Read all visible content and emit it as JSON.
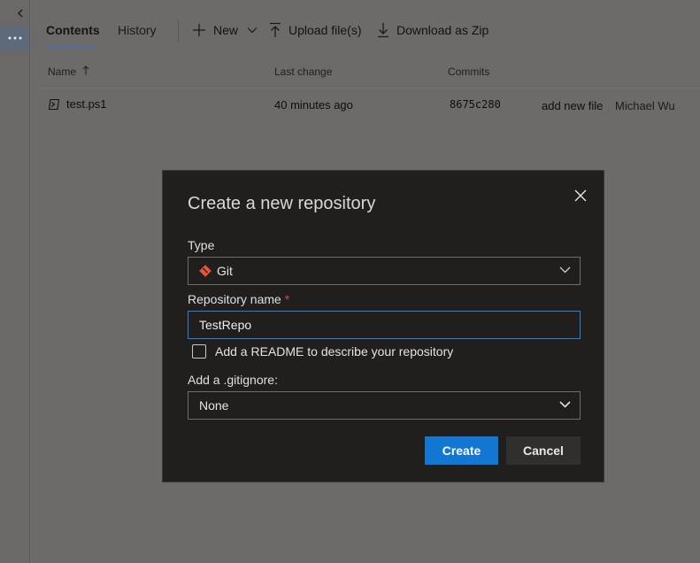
{
  "header": {
    "tabs": [
      {
        "label": "Contents",
        "active": true
      },
      {
        "label": "History",
        "active": false
      }
    ],
    "actions": {
      "new_label": "New",
      "upload_label": "Upload file(s)",
      "download_label": "Download as Zip"
    }
  },
  "table": {
    "columns": {
      "name": "Name",
      "last_change": "Last change",
      "commits": "Commits"
    },
    "rows": [
      {
        "name": "test.ps1",
        "last_change": "40 minutes ago",
        "commit": "8675c280",
        "message": "add new file",
        "author": "Michael Wu"
      }
    ]
  },
  "dialog": {
    "title": "Create a new repository",
    "type_label": "Type",
    "type_value": "Git",
    "repo_name_label": "Repository name",
    "required_mark": "*",
    "repo_name_value": "TestRepo",
    "readme_label": "Add a README to describe your repository",
    "readme_checked": false,
    "gitignore_label": "Add a .gitignore:",
    "gitignore_value": "None",
    "create_label": "Create",
    "cancel_label": "Cancel"
  },
  "colors": {
    "accent": "#1177d2",
    "git_icon": "#e8553a",
    "required": "#d1495b"
  },
  "icons": [
    "chevron-left-icon",
    "more-icon",
    "plus-icon",
    "chevron-down-icon",
    "upload-icon",
    "download-icon",
    "sort-ascending-icon",
    "powershell-file-icon",
    "close-icon",
    "git-icon"
  ]
}
